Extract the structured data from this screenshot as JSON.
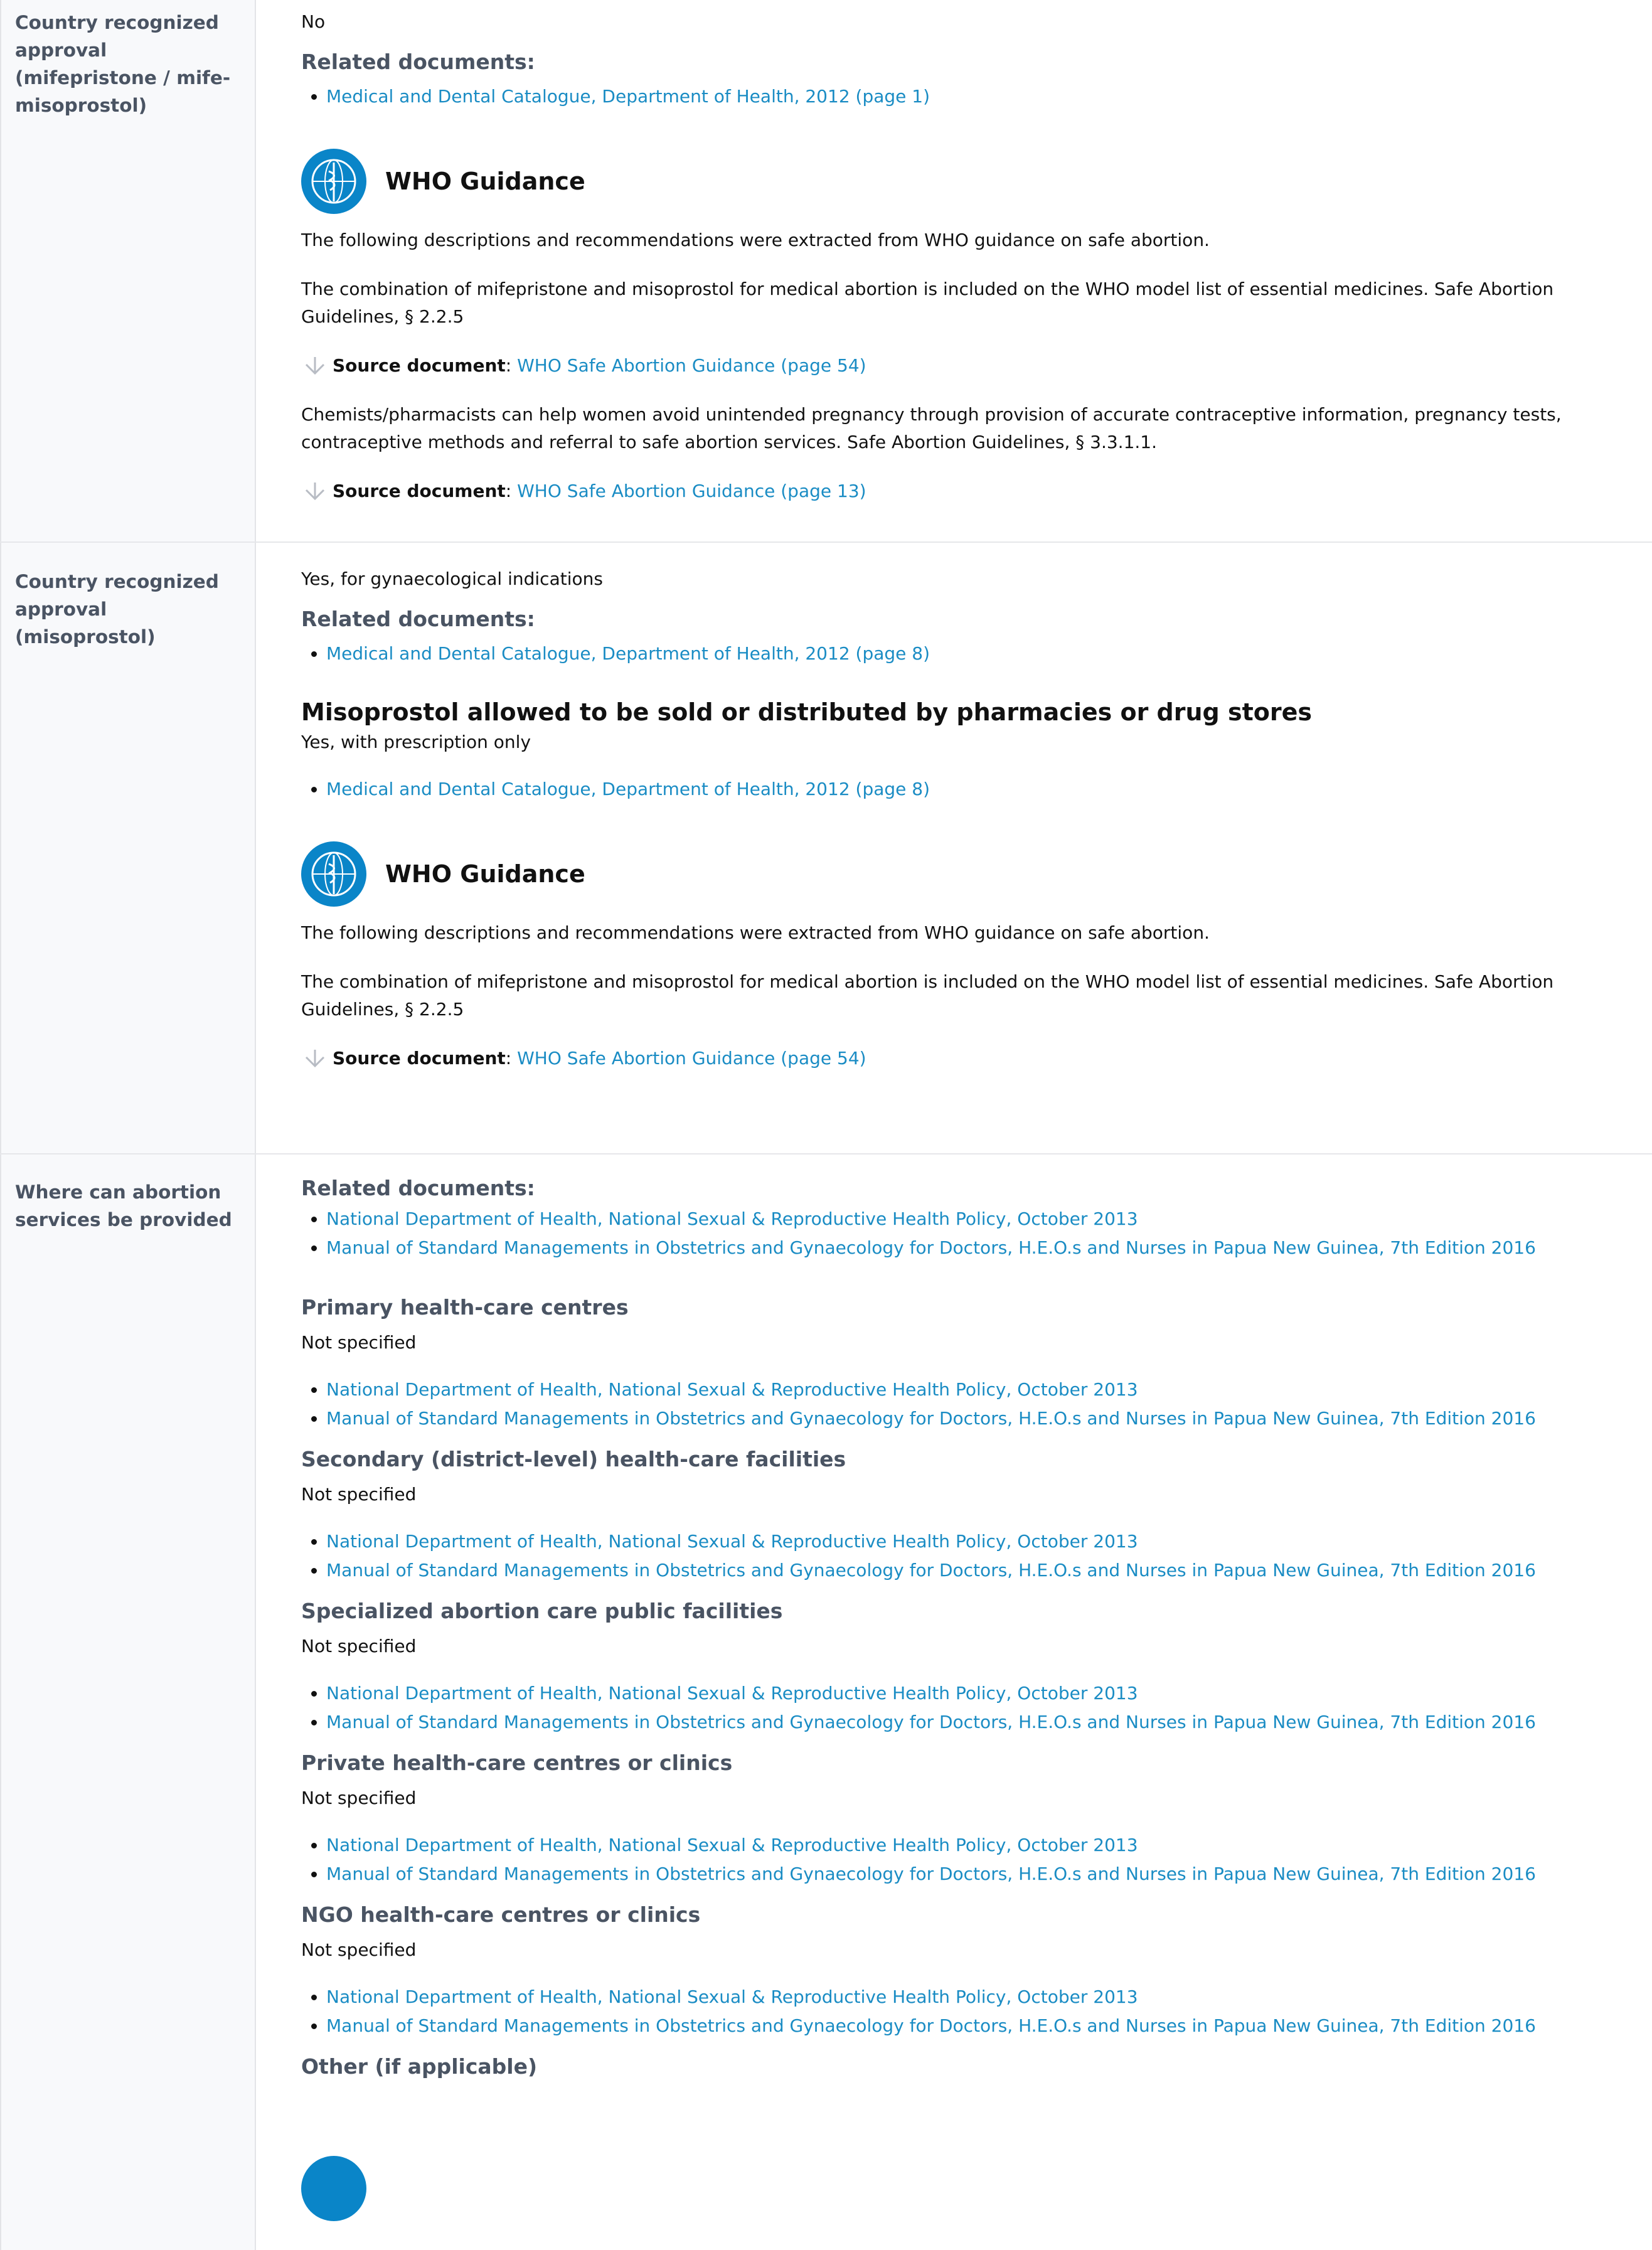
{
  "rows": {
    "mife": {
      "label": "Country recognized approval (mifepristone / mife-misoprostol)",
      "value": "No",
      "related_heading": "Related documents:",
      "docs": [
        "Medical and Dental Catalogue, Department of Health, 2012 (page 1)"
      ],
      "who": {
        "title": "WHO Guidance",
        "intro": "The following descriptions and recommendations were extracted from WHO guidance on safe abortion.",
        "p1": "The combination of mifepristone and misoprostol for medical abortion is included on the WHO model list of essential medicines. Safe Abortion Guidelines, § 2.2.5",
        "src1_label": "Source document",
        "src1_link": "WHO Safe Abortion Guidance (page 54)",
        "p2": "Chemists/pharmacists can help women avoid unintended pregnancy through provision of accurate contraceptive information, pregnancy tests, contraceptive methods and referral to safe abortion services. Safe Abortion Guidelines, § 3.3.1.1.",
        "src2_label": "Source document",
        "src2_link": "WHO Safe Abortion Guidance (page 13)"
      }
    },
    "miso": {
      "label": "Country recognized approval (misoprostol)",
      "value": "Yes, for gynaecological indications",
      "related_heading": "Related documents:",
      "docs": [
        "Medical and Dental Catalogue, Department of Health, 2012 (page 8)"
      ],
      "pharmacy_heading": "Misoprostol allowed to be sold or distributed by pharmacies or drug stores",
      "pharmacy_value": "Yes, with prescription only",
      "pharmacy_docs": [
        "Medical and Dental Catalogue, Department of Health, 2012 (page 8)"
      ],
      "who": {
        "title": "WHO Guidance",
        "intro": "The following descriptions and recommendations were extracted from WHO guidance on safe abortion.",
        "p1": "The combination of mifepristone and misoprostol for medical abortion is included on the WHO model list of essential medicines. Safe Abortion Guidelines, § 2.2.5",
        "src1_label": "Source document",
        "src1_link": "WHO Safe Abortion Guidance (page 54)"
      }
    },
    "where": {
      "label": "Where can abortion services be provided",
      "related_heading": "Related documents:",
      "docs": [
        "National Department of Health, National Sexual & Reproductive Health Policy, October 2013",
        "Manual of Standard Managements in Obstetrics and Gynaecology for Doctors, H.E.O.s and Nurses in Papua New Guinea, 7th Edition 2016"
      ],
      "sections": [
        {
          "title": "Primary health-care centres",
          "value": "Not specified",
          "docs": [
            "National Department of Health, National Sexual & Reproductive Health Policy, October 2013",
            "Manual of Standard Managements in Obstetrics and Gynaecology for Doctors, H.E.O.s and Nurses in Papua New Guinea, 7th Edition 2016"
          ]
        },
        {
          "title": "Secondary (district-level) health-care facilities",
          "value": "Not specified",
          "docs": [
            "National Department of Health, National Sexual & Reproductive Health Policy, October 2013",
            "Manual of Standard Managements in Obstetrics and Gynaecology for Doctors, H.E.O.s and Nurses in Papua New Guinea, 7th Edition 2016"
          ]
        },
        {
          "title": "Specialized abortion care public facilities",
          "value": "Not specified",
          "docs": [
            "National Department of Health, National Sexual & Reproductive Health Policy, October 2013",
            "Manual of Standard Managements in Obstetrics and Gynaecology for Doctors, H.E.O.s and Nurses in Papua New Guinea, 7th Edition 2016"
          ]
        },
        {
          "title": "Private health-care centres or clinics",
          "value": "Not specified",
          "docs": [
            "National Department of Health, National Sexual & Reproductive Health Policy, October 2013",
            "Manual of Standard Managements in Obstetrics and Gynaecology for Doctors, H.E.O.s and Nurses in Papua New Guinea, 7th Edition 2016"
          ]
        },
        {
          "title": "NGO health-care centres or clinics",
          "value": "Not specified",
          "docs": [
            "National Department of Health, National Sexual & Reproductive Health Policy, October 2013",
            "Manual of Standard Managements in Obstetrics and Gynaecology for Doctors, H.E.O.s and Nurses in Papua New Guinea, 7th Edition 2016"
          ]
        }
      ],
      "other_title": "Other (if applicable)"
    }
  },
  "colors": {
    "link": "#1a8cc4",
    "label": "#4a5463",
    "who_blue": "#0a85c8",
    "divider": "#e6e7ea"
  }
}
